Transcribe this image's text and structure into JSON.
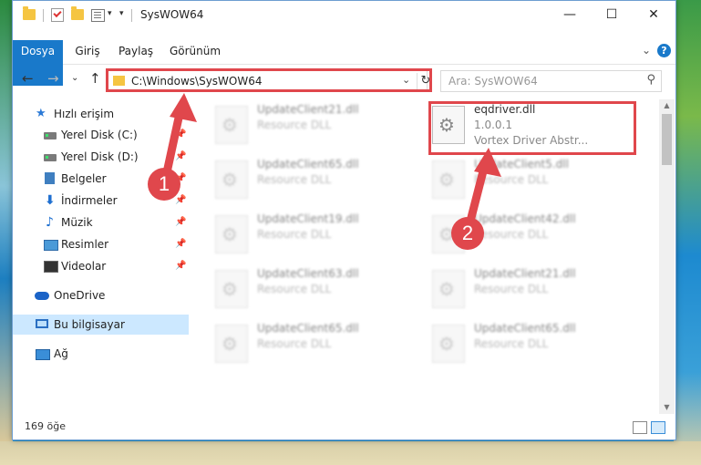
{
  "window": {
    "title": "SysWOW64",
    "minimize": "—",
    "maximize": "☐",
    "close": "✕"
  },
  "ribbon": {
    "tabs": [
      "Dosya",
      "Giriş",
      "Paylaş",
      "Görünüm"
    ],
    "expand": "⌄",
    "help": "?"
  },
  "address": {
    "path": "C:\\Windows\\SysWOW64",
    "dropdown": "⌄",
    "refresh": "↻"
  },
  "nav_buttons": {
    "back": "←",
    "forward": "→",
    "recent": "⌄",
    "up": "↑"
  },
  "search": {
    "placeholder": "Ara: SysWOW64",
    "icon": "⚲"
  },
  "sidebar": {
    "items": [
      {
        "label": "Hızlı erişim",
        "icon": "star-icon"
      },
      {
        "label": "Yerel Disk (C:)",
        "icon": "drive-icon",
        "pinned": true
      },
      {
        "label": "Yerel Disk (D:)",
        "icon": "drive-icon",
        "pinned": true
      },
      {
        "label": "Belgeler",
        "icon": "documents-icon",
        "pinned": true
      },
      {
        "label": "İndirmeler",
        "icon": "download-icon",
        "pinned": true
      },
      {
        "label": "Müzik",
        "icon": "music-icon",
        "pinned": true
      },
      {
        "label": "Resimler",
        "icon": "pictures-icon",
        "pinned": true
      },
      {
        "label": "Videolar",
        "icon": "videos-icon",
        "pinned": true
      },
      {
        "label": "OneDrive",
        "icon": "onedrive-icon"
      },
      {
        "label": "Bu bilgisayar",
        "icon": "computer-icon",
        "selected": true
      },
      {
        "label": "Ağ",
        "icon": "network-icon"
      }
    ],
    "pin_glyph": "📌"
  },
  "files": [
    {
      "name": "UpdateClient21.dll",
      "desc": "Resource DLL"
    },
    {
      "name": "eqdriver.dll",
      "version": "1.0.0.1",
      "desc": "Vortex Driver Abstr..."
    },
    {
      "name": "UpdateClient65.dll",
      "desc": "Resource DLL"
    },
    {
      "name": "UpdateClient5.dll",
      "desc": "Resource DLL"
    },
    {
      "name": "UpdateClient19.dll",
      "desc": "Resource DLL"
    },
    {
      "name": "UpdateClient42.dll",
      "desc": "Resource DLL"
    },
    {
      "name": "UpdateClient63.dll",
      "desc": "Resource DLL"
    },
    {
      "name": "UpdateClient21.dll",
      "desc": "Resource DLL"
    },
    {
      "name": "UpdateClient65.dll",
      "desc": "Resource DLL"
    },
    {
      "name": "UpdateClient65.dll",
      "desc": "Resource DLL"
    }
  ],
  "status": {
    "count": "169 öğe"
  },
  "callouts": [
    "1",
    "2"
  ],
  "colors": {
    "accent": "#1979ca",
    "highlight": "#e0474c",
    "selected": "#cce8ff"
  }
}
